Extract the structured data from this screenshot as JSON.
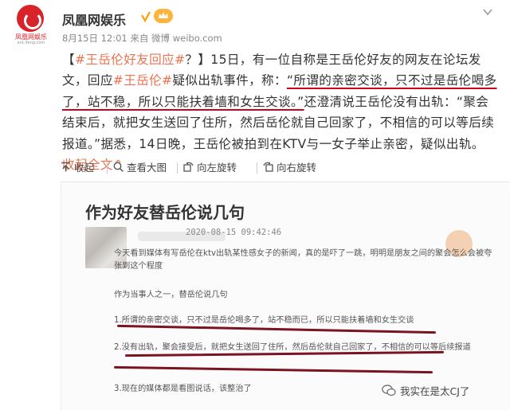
{
  "header": {
    "avatar_text": "凤凰网娱乐",
    "avatar_sub": "ent.ifeng.com",
    "user_name": "凤凰网娱乐",
    "meta": "8月15日 12:01 来自 微博 weibo.com"
  },
  "post": {
    "lead": "【",
    "tag1": "#王岳伦好友回应#",
    "t1": "？】15日，有一位自称是王岳伦好友的网友在论坛发文，回应",
    "tag2": "#王岳伦#",
    "t2": "疑似出轨事件，称：",
    "quote": "“所谓的亲密交谈，只不过是岳伦喝多了，站不稳，所以只能扶着墙和女生交谈。”",
    "t3": "还澄清说王岳伦没有出轨：“聚会结束后，就把女生送回了住所，然后岳伦就自己回家了，不相信的可以等后续报道。”据悉，14日晚，王岳伦被拍到在KTV与一女子举止亲密，疑似出轨。",
    "collapse": "收起全文",
    "collapse_arrow": "⌃"
  },
  "actions": {
    "collapse": "收起",
    "view_large": "查看大图",
    "rotate_left": "向左旋转",
    "rotate_right": "向右旋转"
  },
  "screenshot": {
    "title": "作为好友替岳伦说几句",
    "time": "2020-08-15 09:42:46",
    "p1": "今天看到媒体有写岳伦在ktv出轨某性感女子的新闻，真的是吓了一跳，明明是朋友之间的聚会怎么会被夸张到这个程度",
    "p2": "作为当事人之一，替岳伦说几句",
    "p3": "1.所谓的亲密交谈，只不过是岳伦喝多了，站不稳而已，所以只能扶着墙和女生交谈",
    "p4": "2.没有出轨，聚会接受后，就把女生送回了住所，然后岳伦就自己回家了，不相信的可以等后续报道",
    "p5": "3.现在的媒体都是看图说话，该整治了",
    "watermark": "我实在是太CJ了"
  },
  "colors": {
    "link": "#eb7350",
    "brand_red": "#d8232a",
    "underline_red": "#d0021b",
    "pen": "#7a1420"
  }
}
